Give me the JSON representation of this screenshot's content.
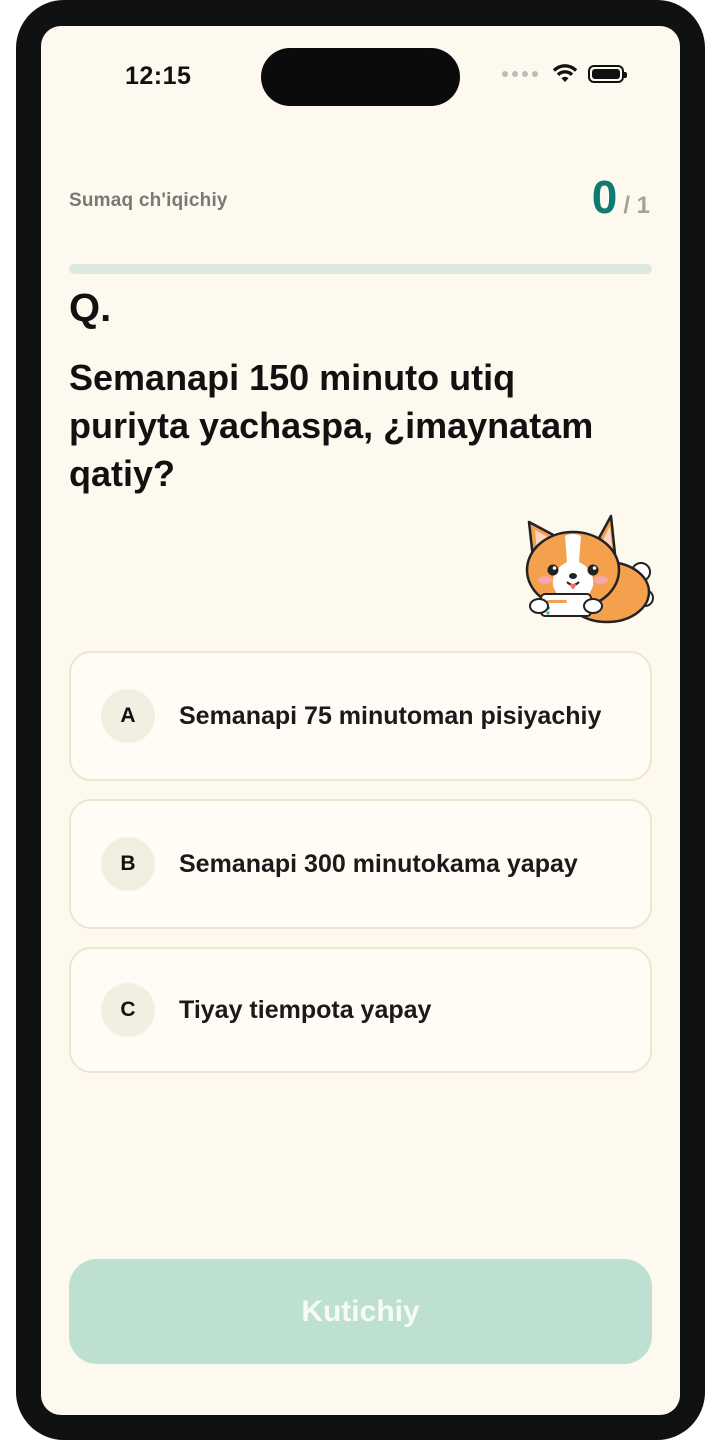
{
  "status_bar": {
    "time": "12:15",
    "icons": [
      "signal-dots-icon",
      "wifi-icon",
      "battery-icon"
    ]
  },
  "header": {
    "title": "Sumaq ch'iqichiy",
    "score_current": "0",
    "score_total": "/ 1",
    "progress": 0
  },
  "question": {
    "marker": "Q.",
    "text": "Semanapi 150 minuto utiq puriyta yachaspa, ¿imaynatam qatiy?"
  },
  "answers": [
    {
      "letter": "A",
      "text": "Semanapi 75 minutoman pisiyachiy"
    },
    {
      "letter": "B",
      "text": "Semanapi 300 minutokama yapay"
    },
    {
      "letter": "C",
      "text": "Tiyay tiempota yapay"
    }
  ],
  "footer": {
    "continue_label": "Kutichiy"
  },
  "colors": {
    "background": "#fdf9ef",
    "accent": "#0f7a73",
    "button_disabled": "#bde0d1",
    "progress_track": "#dde9df"
  }
}
